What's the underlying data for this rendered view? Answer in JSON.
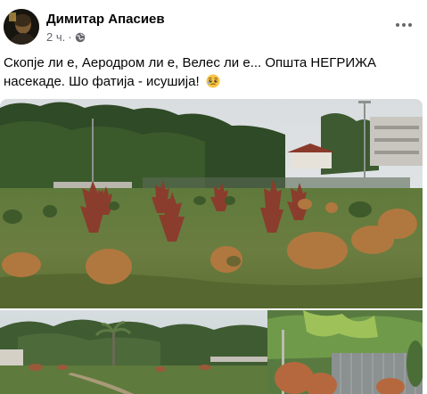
{
  "post": {
    "author": "Димитар Апасиев",
    "time": "2 ч.",
    "separator": "·",
    "privacy_icon": "globe-icon",
    "text": "Скопје ли е, Аеродром ли е, Велес ли е... Општа НЕГРИЖА насекаде. Шо фатија - исушија!",
    "emoji": "pleading-face-emoji"
  },
  "colors": {
    "author_text": "#050505",
    "meta_text": "#65676b",
    "background": "#ffffff"
  },
  "photos": [
    {
      "name": "park-dried-pines-photo"
    },
    {
      "name": "park-dried-hedge-photo"
    }
  ]
}
